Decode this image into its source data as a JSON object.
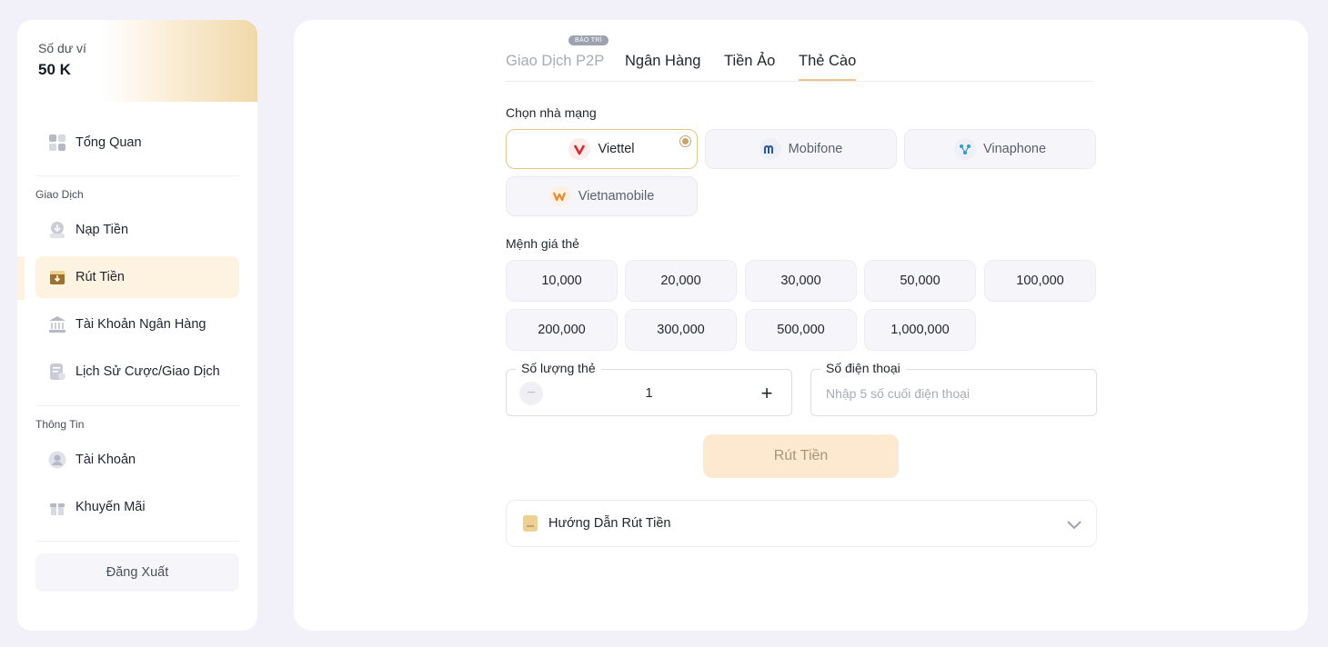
{
  "wallet": {
    "label": "Số dư ví",
    "balance": "50 K"
  },
  "sidebar": {
    "overview": "Tổng Quan",
    "section_transactions": "Giao Dịch",
    "deposit": "Nạp Tiền",
    "withdraw": "Rút Tiền",
    "bank_account": "Tài Khoản Ngân Hàng",
    "history": "Lịch Sử Cược/Giao Dịch",
    "section_info": "Thông Tin",
    "account": "Tài Khoản",
    "promotions": "Khuyến Mãi",
    "logout": "Đăng Xuất",
    "active_item": "withdraw"
  },
  "tabs": [
    {
      "label": "Giao Dịch P2P",
      "badge": "BẢO TRÌ",
      "state": "disabled"
    },
    {
      "label": "Ngân Hàng",
      "state": "normal"
    },
    {
      "label": "Tiền Ảo",
      "state": "normal"
    },
    {
      "label": "Thẻ Cào",
      "state": "active"
    }
  ],
  "carrier_section": {
    "label": "Chọn nhà mạng",
    "options": [
      {
        "name": "Viettel",
        "selected": true,
        "icon": "viettel-logo-icon"
      },
      {
        "name": "Mobifone",
        "selected": false,
        "icon": "mobifone-logo-icon"
      },
      {
        "name": "Vinaphone",
        "selected": false,
        "icon": "vinaphone-logo-icon"
      },
      {
        "name": "Vietnamobile",
        "selected": false,
        "icon": "vietnamobile-logo-icon"
      }
    ]
  },
  "denomination_section": {
    "label": "Mệnh giá thẻ",
    "values": [
      "10,000",
      "20,000",
      "30,000",
      "50,000",
      "100,000",
      "200,000",
      "300,000",
      "500,000",
      "1,000,000"
    ]
  },
  "quantity": {
    "label": "Số lượng thẻ",
    "value": "1",
    "minus": "−",
    "plus": "+"
  },
  "phone": {
    "label": "Số điện thoại",
    "placeholder": "Nhập 5 số cuối điện thoại"
  },
  "submit_label": "Rút Tiền",
  "guide_label": "Hướng Dẫn Rút Tiền",
  "colors": {
    "accent": "#e9c58a",
    "active_bg": "#fef3e1",
    "button_bg": "#fde9cf",
    "page_bg": "#f2f1f9"
  }
}
